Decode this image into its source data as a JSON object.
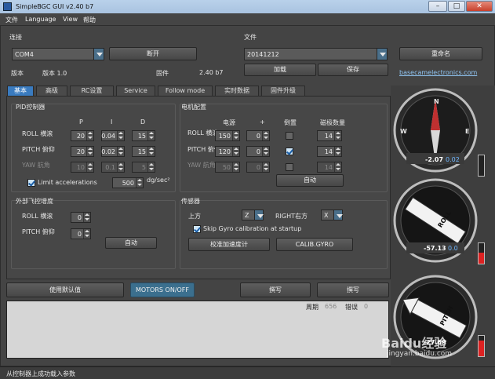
{
  "window": {
    "title": "SimpleBGC GUI v2.40 b7",
    "min": "–",
    "max": "□",
    "close": "✕"
  },
  "menu": [
    "文件",
    "Language",
    "View",
    "帮助"
  ],
  "connection": {
    "legend": "连接",
    "port": "COM4",
    "connect_button": "断开",
    "version_label": "版本",
    "version_value": "版本 1.0",
    "firmware_label": "固件",
    "firmware_value": "2.40 b7"
  },
  "file": {
    "legend": "文件",
    "profile": "20141212",
    "rename_button": "重命名",
    "load_button": "加载",
    "save_button": "保存",
    "link": "basecamelectronics.com"
  },
  "tabs": [
    {
      "label": "基本",
      "active": true
    },
    {
      "label": "高级"
    },
    {
      "label": "RC设置"
    },
    {
      "label": "Service"
    },
    {
      "label": "Follow mode"
    },
    {
      "label": "实时数据"
    },
    {
      "label": "固件升级"
    }
  ],
  "pid": {
    "legend": "PID控制器",
    "col_p": "P",
    "col_i": "I",
    "col_d": "D",
    "rows": [
      {
        "label": "ROLL 横滚",
        "p": "20",
        "i": "0.04",
        "d": "15"
      },
      {
        "label": "PITCH 俯仰",
        "p": "20",
        "i": "0.02",
        "d": "15"
      },
      {
        "label": "YAW 航角",
        "p": "10",
        "i": "0.1",
        "d": "5"
      }
    ],
    "limit_label": "Limit accelerations",
    "limit_value": "500",
    "limit_unit": "dg/sec²"
  },
  "motor": {
    "legend": "电机配置",
    "col_power": "电源",
    "col_plus": "+",
    "col_invert": "倒置",
    "col_poles": "磁极数量",
    "rows": [
      {
        "label": "ROLL 横滚",
        "power": "150",
        "plus": "0",
        "inverted": false,
        "poles": "14"
      },
      {
        "label": "PITCH 俯仰",
        "power": "120",
        "plus": "0",
        "inverted": true,
        "poles": "14"
      },
      {
        "label": "YAW 航角",
        "power": "50",
        "plus": "0",
        "inverted": false,
        "poles": "14"
      }
    ],
    "auto_button": "自动"
  },
  "ext": {
    "legend": "外部飞控增度",
    "roll_label": "ROLL 横滚",
    "roll_value": "0",
    "pitch_label": "PITCH 俯仰",
    "pitch_value": "0",
    "auto_button": "自动"
  },
  "sensor": {
    "legend": "传感器",
    "top_label": "上方",
    "top_value": "Z",
    "right_label": "RIGHT右方",
    "right_value": "X",
    "skip_gyro_label": "Skip Gyro calibration at startup",
    "calib_acc_button": "校准加速度计",
    "calib_gyro_button": "CALIB.GYRO"
  },
  "bottom": {
    "defaults_button": "使用默认值",
    "motors_button": "MOTORS ON/OFF",
    "write_button": "撰写",
    "read_button": "撰写"
  },
  "log": {
    "period_label": "周期",
    "period_value": "656",
    "error_label": "错误",
    "error_value": "0"
  },
  "gauges": {
    "yaw": {
      "value": "-2.07",
      "rate": "0.02",
      "n": "N",
      "w": "W",
      "e": "E"
    },
    "roll": {
      "label": "ROLL",
      "value": "-57.13",
      "rate": "0.0"
    },
    "pitch": {
      "label": "PITCH",
      "value": "-27.69"
    }
  },
  "status": "从控制器上成功载入参数",
  "watermark": {
    "brand": "Baidu经验",
    "url": "jingyan.baidu.com"
  }
}
